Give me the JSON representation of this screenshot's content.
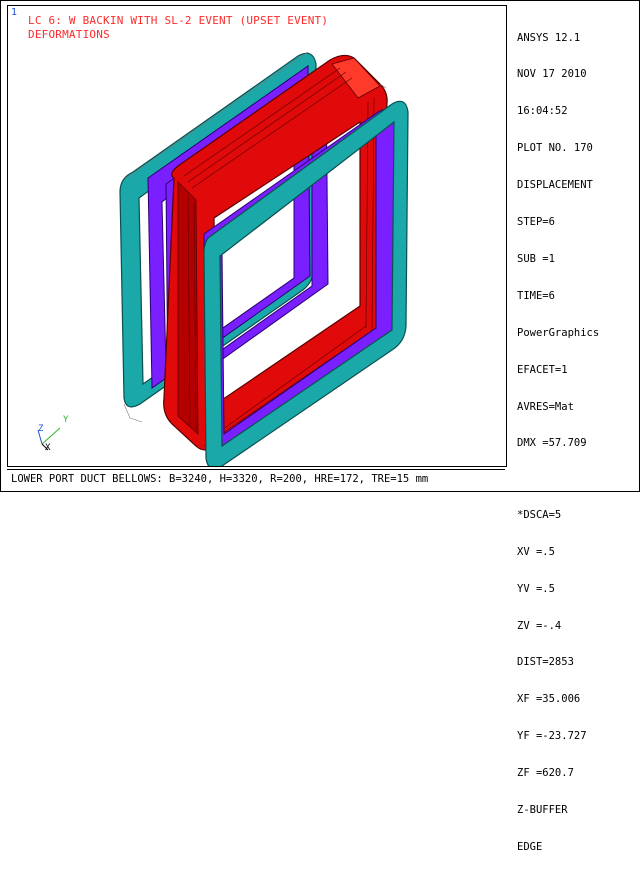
{
  "viewport": {
    "window_number": "1",
    "title_lines": [
      "LC 6: W BACKIN WITH SL-2 EVENT (UPSET EVENT)",
      "DEFORMATIONS"
    ],
    "triad": {
      "x_label": "X",
      "y_label": "Y",
      "z_label": "Z"
    },
    "colors": {
      "title": "#ff2a2a",
      "red_body": "#e00a0a",
      "purple": "#7a1fff",
      "teal": "#1aa8a8"
    }
  },
  "side_panel": {
    "block1": [
      "ANSYS 12.1",
      "NOV 17 2010",
      "16:04:52",
      "PLOT NO. 170",
      "DISPLACEMENT",
      "STEP=6",
      "SUB =1",
      "TIME=6",
      "PowerGraphics",
      "EFACET=1",
      "AVRES=Mat",
      "DMX =57.709"
    ],
    "block2": [
      "*DSCA=5",
      "XV =.5",
      "YV =.5",
      "ZV =-.4",
      "DIST=2853",
      "XF =35.006",
      "YF =-23.727",
      "ZF =620.7",
      "Z-BUFFER",
      "EDGE"
    ]
  },
  "footer": {
    "text": "LOWER PORT DUCT BELLOWS: B=3240, H=3320, R=200, HRE=172, TRE=15 mm"
  }
}
